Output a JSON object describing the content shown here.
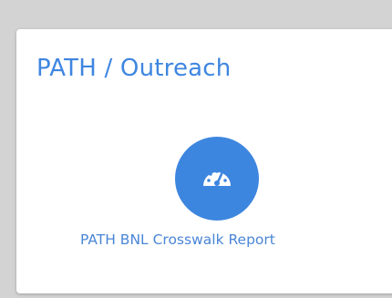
{
  "panel": {
    "title": "PATH / Outreach"
  },
  "reports": [
    {
      "label": "PATH BNL Crosswalk Report",
      "icon": "speedometer-icon"
    }
  ],
  "colors": {
    "background": "#d3d3d3",
    "card": "#ffffff",
    "accent": "#3d86df",
    "title": "#3f86e0",
    "label": "#4a86d6"
  }
}
